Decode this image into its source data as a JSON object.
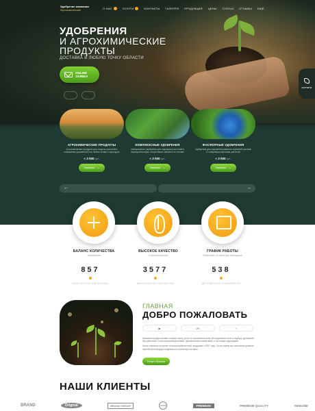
{
  "header": {
    "logo_line1": "Удобрение компании",
    "logo_line2": "Агрохимические",
    "nav": [
      "О НАС",
      "УСЛУГИ",
      "КОНТАКТЫ",
      "ГАЛЕРЕЯ",
      "ПРОДУКЦИЯ",
      "ЦЕНЫ",
      "СТАТЬИ",
      "ОТЗЫВЫ",
      "ЕЩЁ"
    ]
  },
  "hero": {
    "title_line1": "УДОБРЕНИЯ",
    "title_line2": "И АГРОХИМИЧЕСКИЕ ПРОДУКТЫ",
    "subtitle": "ДОСТАВКА В ЛЮБУЮ ТОЧКУ ОБЛАСТИ",
    "cta_line1": "ONLINE",
    "cta_line2": "ЗАЯВКА",
    "contact_label": "контакты"
  },
  "products": [
    {
      "name": "АГРОХИМИЧЕСКИЕ ПРОДУКТЫ",
      "desc": "Агрохимические продукты для защиты растений и повышения урожайности на любых почвах и культурах",
      "price": "≈ 3 000",
      "currency": "руб.",
      "button": "Заказать"
    },
    {
      "name": "КОМПЛЕКСНЫЕ УДОБРЕНИЯ",
      "desc": "Минеральные удобрения для подкормки растений в период вегетации, питательные элементы в составе",
      "price": "≈ 3 000",
      "currency": "руб.",
      "button": "Заказать"
    },
    {
      "name": "ФОСФОРНЫЕ УДОБРЕНИЯ",
      "desc": "Удобрения для улучшения развития корневой системы и стимуляции цветения растений",
      "price": "≈ 3 000",
      "currency": "руб.",
      "button": "Заказать"
    }
  ],
  "slider": {
    "prev": "←",
    "next": "→"
  },
  "features": [
    {
      "title": "БАЛАНС КОЛИЧЕСТВА",
      "sub": "Элементов",
      "icon": "network-icon"
    },
    {
      "title": "ВЫСОКОЕ КАЧЕСТВО",
      "sub": "и экологичность",
      "icon": "wheat-icon"
    },
    {
      "title": "ГРАФИК РАБОТЫ",
      "sub": "Работаем 24 часа без выходных",
      "icon": "schedule-icon"
    }
  ],
  "stats": [
    {
      "num": "857",
      "label": "КОНТАКТОВ НАПИСАНО"
    },
    {
      "num": "3577",
      "label": "ВЫПОЛНЕНО ПРОЕКТОВ"
    },
    {
      "num": "538",
      "label": "ДОГОВОРОВ ЗАКЛЮЧЕНО"
    }
  ],
  "welcome": {
    "small": "ГЛАВНАЯ",
    "big": "ДОБРО ПОЖАЛОВАТЬ",
    "socials": [
      "▶",
      "VK",
      "f"
    ],
    "text1": "Компания предоставляет полный спектр услуг по агрохимическому обследованию почв и подбору удобрений. Мы работаем с сельхозпроизводителями, фермерскими хозяйствами и частными садоводами.",
    "text2": "Наша компания на рынке сельскохозяйственной продукции с 2007 года. За это время мы заслужили доверие партнёров благодаря надёжности и качеству поставок.",
    "button": "Узнать больше"
  },
  "clients": {
    "title": "НАШИ КЛИЕНТЫ",
    "logos": [
      "BRAND",
      "Original",
      "BRAND GROUP",
      "LOGO",
      "PREMIUM",
      "PREMIUM QUALITY",
      "GENUINE"
    ]
  },
  "colors": {
    "accent_green": "#6aa13a",
    "accent_orange": "#f2a81d",
    "band": "#1e3a32"
  }
}
